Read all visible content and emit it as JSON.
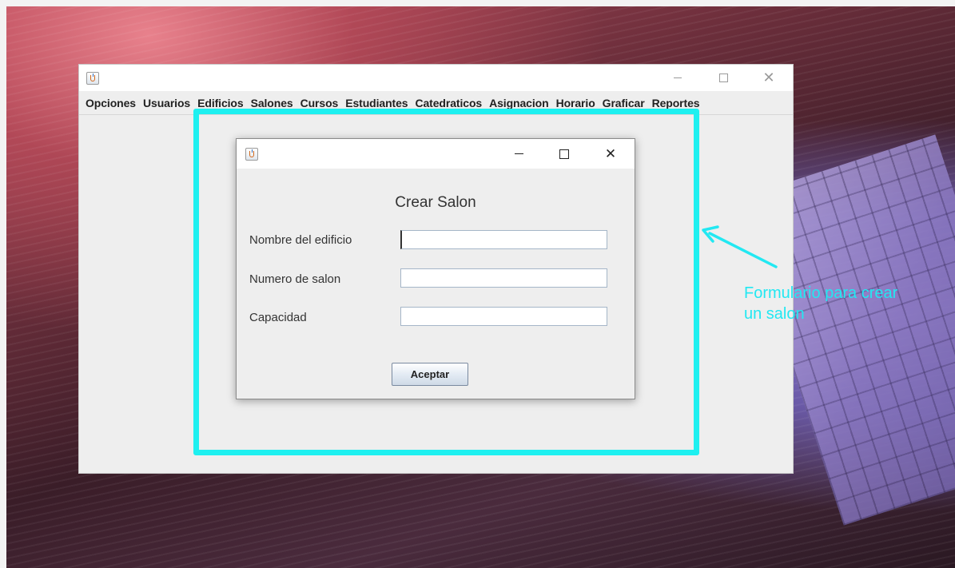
{
  "main_window": {
    "menu": [
      "Opciones",
      "Usuarios",
      "Edificios",
      "Salones",
      "Cursos",
      "Estudiantes",
      "Catedraticos",
      "Asignacion",
      "Horario",
      "Graficar",
      "Reportes"
    ]
  },
  "dialog": {
    "title": "Crear Salon",
    "fields": [
      {
        "label": "Nombre del edificio",
        "value": "",
        "placeholder": ""
      },
      {
        "label": "Numero de salon",
        "value": "",
        "placeholder": ""
      },
      {
        "label": "Capacidad",
        "value": "",
        "placeholder": ""
      }
    ],
    "accept_label": "Aceptar"
  },
  "annotation": {
    "line1": "Formulario para crear",
    "line2": "un salon",
    "color": "#22e8f2"
  },
  "icons": {
    "app": "java-app-icon",
    "minimize": "minimize-icon",
    "maximize": "maximize-icon",
    "close": "close-icon"
  }
}
